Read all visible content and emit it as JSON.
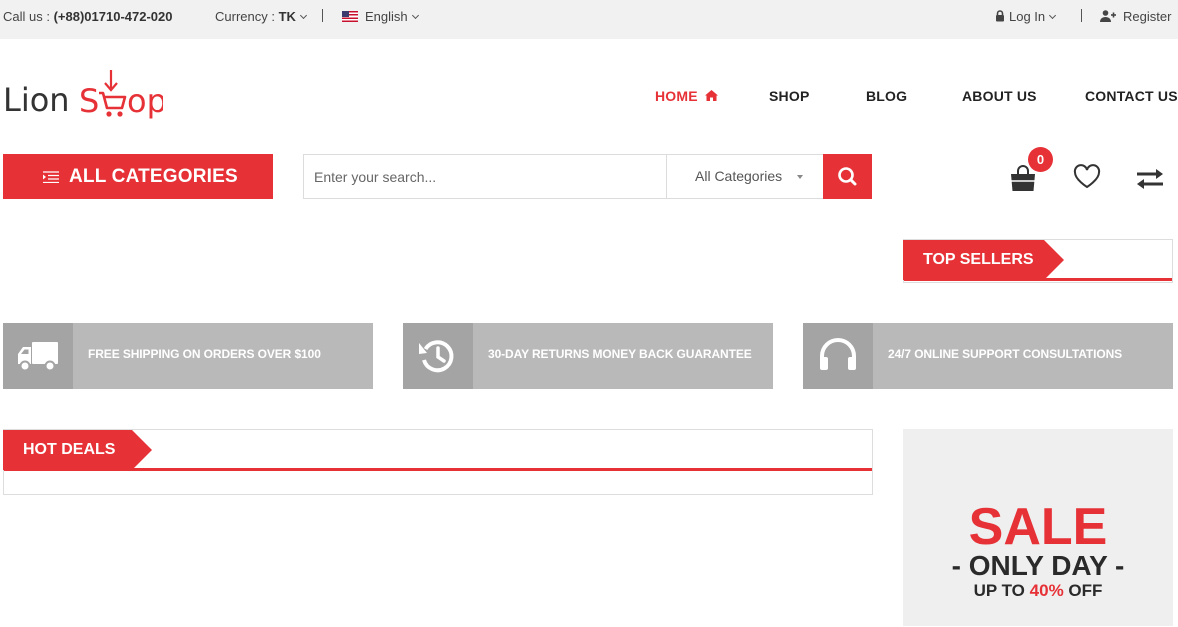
{
  "topbar": {
    "call_label": "Call us :",
    "phone": "(+88)01710-472-020",
    "currency_label": "Currency :",
    "currency_value": "TK",
    "language": "English",
    "login": "Log In",
    "register": "Register"
  },
  "brand": {
    "part1": "Lion",
    "part2": "S",
    "part3": "op"
  },
  "nav": {
    "items": [
      {
        "label": "HOME",
        "active": true
      },
      {
        "label": "SHOP"
      },
      {
        "label": "BLOG"
      },
      {
        "label": "ABOUT US"
      },
      {
        "label": "CONTACT US"
      }
    ]
  },
  "categories": {
    "label": "ALL CATEGORIES"
  },
  "search": {
    "placeholder": "Enter your search...",
    "category_selected": "All Categories"
  },
  "cart": {
    "count": "0"
  },
  "top_sellers": {
    "title": "TOP SELLERS"
  },
  "features": [
    {
      "icon": "truck-icon",
      "text": "FREE SHIPPING ON ORDERS OVER $100"
    },
    {
      "icon": "history-icon",
      "text": "30-DAY RETURNS MONEY BACK GUARANTEE"
    },
    {
      "icon": "headphones-icon",
      "text": "24/7 ONLINE SUPPORT CONSULTATIONS"
    }
  ],
  "hot_deals": {
    "title": "HOT DEALS"
  },
  "sale_banner": {
    "title": "SALE",
    "subtitle": "- ONLY DAY -",
    "prefix": "UP TO",
    "percent": "40%",
    "suffix": "OFF"
  },
  "colors": {
    "accent": "#e63137",
    "feature_bg": "#b9b9b9",
    "feature_icon_bg": "#a4a4a4",
    "topbar_bg": "#f1f1f1"
  }
}
